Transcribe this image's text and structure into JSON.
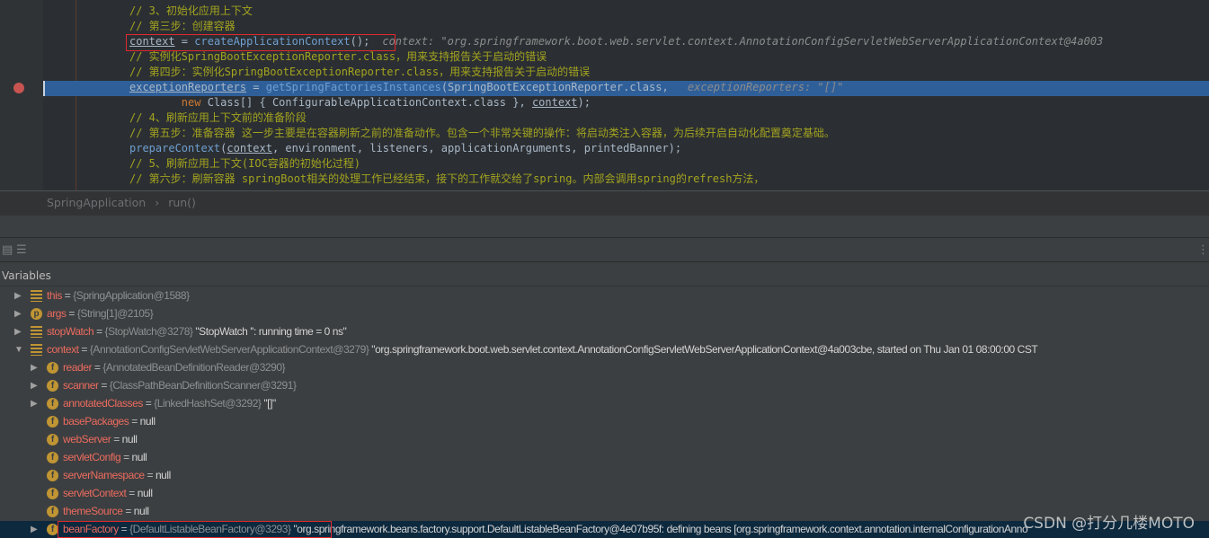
{
  "editor": {
    "lines": [
      {
        "kind": "comment",
        "text": "// 3、初始化应用上下文"
      },
      {
        "kind": "comment",
        "text": "// 第三步：创建容器"
      },
      {
        "kind": "code",
        "var": "context",
        "op": " = ",
        "call": "createApplicationContext",
        "rest": "();",
        "inline": "context: \"org.springframework.boot.web.servlet.context.AnnotationConfigServletWebServerApplicationContext@4a003"
      },
      {
        "kind": "comment",
        "text": "// 实例化SpringBootExceptionReporter.class，用来支持报告关于启动的错误"
      },
      {
        "kind": "comment",
        "text": "// 第四步：实例化SpringBootExceptionReporter.class，用来支持报告关于启动的错误"
      },
      {
        "kind": "code",
        "var": "exceptionReporters",
        "op": " = ",
        "call": "getSpringFactoriesInstances",
        "rest": "(SpringBootExceptionReporter.class, ",
        "inline": "exceptionReporters: \"[]\""
      },
      {
        "kind": "code2",
        "text1": "        new ",
        "text2": "Class[] { ConfigurableApplicationContext.class }, ",
        "var": "context",
        "rest": ");"
      },
      {
        "kind": "comment",
        "text": "// 4、刷新应用上下文前的准备阶段"
      },
      {
        "kind": "comment",
        "text": "// 第五步：准备容器 这一步主要是在容器刷新之前的准备动作。包含一个非常关键的操作：将启动类注入容器，为后续开启自动化配置奠定基础。"
      },
      {
        "kind": "code3",
        "call": "prepareContext",
        "var": "context",
        "rest": ", environment, listeners, applicationArguments, printedBanner);"
      },
      {
        "kind": "comment",
        "text": "// 5、刷新应用上下文(IOC容器的初始化过程)"
      },
      {
        "kind": "comment",
        "text": "// 第六步：刷新容器 springBoot相关的处理工作已经结束，接下的工作就交给了spring。内部会调用spring的refresh方法，"
      }
    ]
  },
  "breadcrumb": [
    "SpringApplication",
    "run()"
  ],
  "variables": {
    "title": "Variables",
    "rows": [
      {
        "name": "this",
        "type": "{SpringApplication@1588}",
        "value": "",
        "icon": "list-icon",
        "expand": "collapsed",
        "level": 0
      },
      {
        "name": "args",
        "type": "{String[1]@2105}",
        "value": "",
        "icon": "parameter-icon",
        "expand": "collapsed",
        "level": 0
      },
      {
        "name": "stopWatch",
        "type": "{StopWatch@3278}",
        "value": "\"StopWatch '': running time = 0 ns\"",
        "icon": "list-icon",
        "expand": "collapsed",
        "level": 0
      },
      {
        "name": "context",
        "type": "{AnnotationConfigServletWebServerApplicationContext@3279}",
        "value": "\"org.springframework.boot.web.servlet.context.AnnotationConfigServletWebServerApplicationContext@4a003cbe, started on Thu Jan 01 08:00:00 CST",
        "icon": "list-icon",
        "expand": "expanded",
        "level": 0
      },
      {
        "name": "reader",
        "type": "{AnnotatedBeanDefinitionReader@3290}",
        "value": "",
        "icon": "field-icon",
        "expand": "collapsed",
        "level": 1
      },
      {
        "name": "scanner",
        "type": "{ClassPathBeanDefinitionScanner@3291}",
        "value": "",
        "icon": "field-icon",
        "expand": "collapsed",
        "level": 1
      },
      {
        "name": "annotatedClasses",
        "type": "{LinkedHashSet@3292}",
        "value": "\"[]\"",
        "icon": "field-icon",
        "expand": "collapsed",
        "level": 1
      },
      {
        "name": "basePackages",
        "type": "",
        "value": "null",
        "icon": "field-icon",
        "expand": "none",
        "level": 1
      },
      {
        "name": "webServer",
        "type": "",
        "value": "null",
        "icon": "field-icon",
        "expand": "none",
        "level": 1
      },
      {
        "name": "servletConfig",
        "type": "",
        "value": "null",
        "icon": "field-icon",
        "expand": "none",
        "level": 1
      },
      {
        "name": "serverNamespace",
        "type": "",
        "value": "null",
        "icon": "field-icon",
        "expand": "none",
        "level": 1
      },
      {
        "name": "servletContext",
        "type": "",
        "value": "null",
        "icon": "field-icon",
        "expand": "none",
        "level": 1
      },
      {
        "name": "themeSource",
        "type": "",
        "value": "null",
        "icon": "field-icon",
        "expand": "none",
        "level": 1
      },
      {
        "name": "beanFactory",
        "type": "{DefaultListableBeanFactory@3293}",
        "value": "\"org.springframework.beans.factory.support.DefaultListableBeanFactory@4e07b95f: defining beans [org.springframework.context.annotation.internalConfigurationAnno",
        "icon": "field-icon",
        "expand": "collapsed",
        "level": 1,
        "selected": true
      }
    ]
  },
  "watermark": "CSDN @打分几楼MOTO"
}
